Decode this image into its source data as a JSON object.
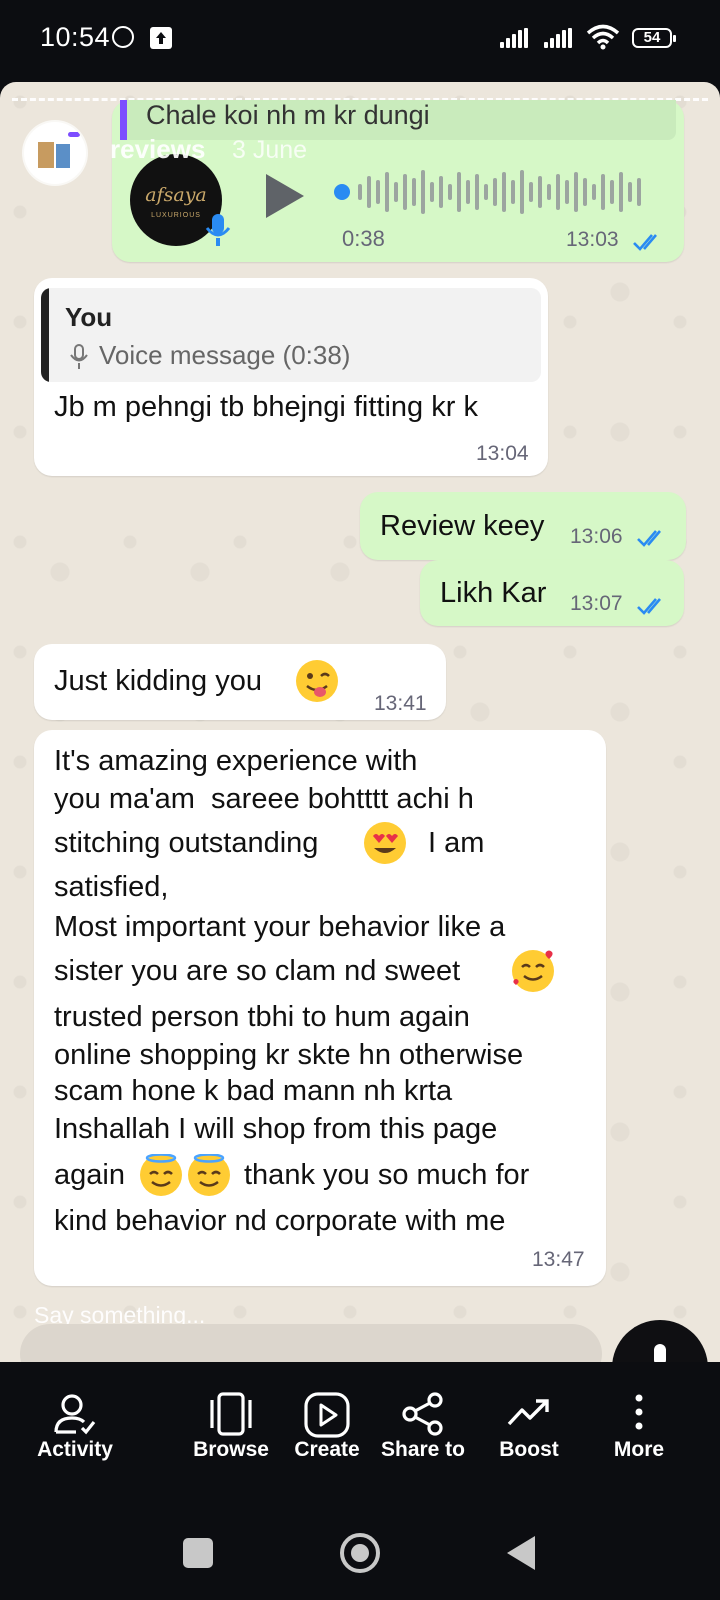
{
  "status_bar": {
    "time": "10:54",
    "battery": "54"
  },
  "story": {
    "username": "reviews",
    "date": "3 June"
  },
  "chat": {
    "quoted_top": "Chale koi  nh m kr dungi",
    "voice_note": {
      "duration": "0:38",
      "time": "13:03"
    },
    "reply_msg": {
      "quote_sender": "You",
      "quote_text": "Voice message (0:38)",
      "text": "Jb m pehngi tb bhejngi fitting kr k",
      "time": "13:04"
    },
    "out_1": {
      "text": "Review keey",
      "time": "13:06"
    },
    "out_2": {
      "text": "Likh Kar",
      "time": "13:07"
    },
    "in_kidding": {
      "text": "Just kidding you",
      "time": "13:41"
    },
    "review": {
      "lines": [
        "It's amazing experience with",
        "you ma'am  sareee bohtttt achi h",
        "stitching outstanding",
        "I am",
        "satisfied,",
        "Most important your behavior like a",
        "sister you are so clam nd sweet",
        "trusted person tbhi to hum again",
        "online shopping kr skte hn otherwise",
        "scam hone k bad mann nh krta",
        "Inshallah I will shop from this page",
        "again",
        "thank you so much for",
        "kind behavior nd corporate with me"
      ],
      "time": "13:47"
    }
  },
  "reply": {
    "placeholder": "Say something..."
  },
  "actions": [
    {
      "label": "Activity",
      "icon": "activity-icon"
    },
    {
      "label": "Browse",
      "icon": "browse-icon"
    },
    {
      "label": "Create",
      "icon": "create-icon"
    },
    {
      "label": "Share to",
      "icon": "share-icon"
    },
    {
      "label": "Boost",
      "icon": "boost-icon"
    },
    {
      "label": "More",
      "icon": "more-icon"
    }
  ],
  "colors": {
    "outgoing_bubble": "#d6f8c7",
    "incoming_bubble": "#ffffff",
    "tick_blue": "#2a8bf2",
    "quote_accent": "#7c4dff"
  }
}
